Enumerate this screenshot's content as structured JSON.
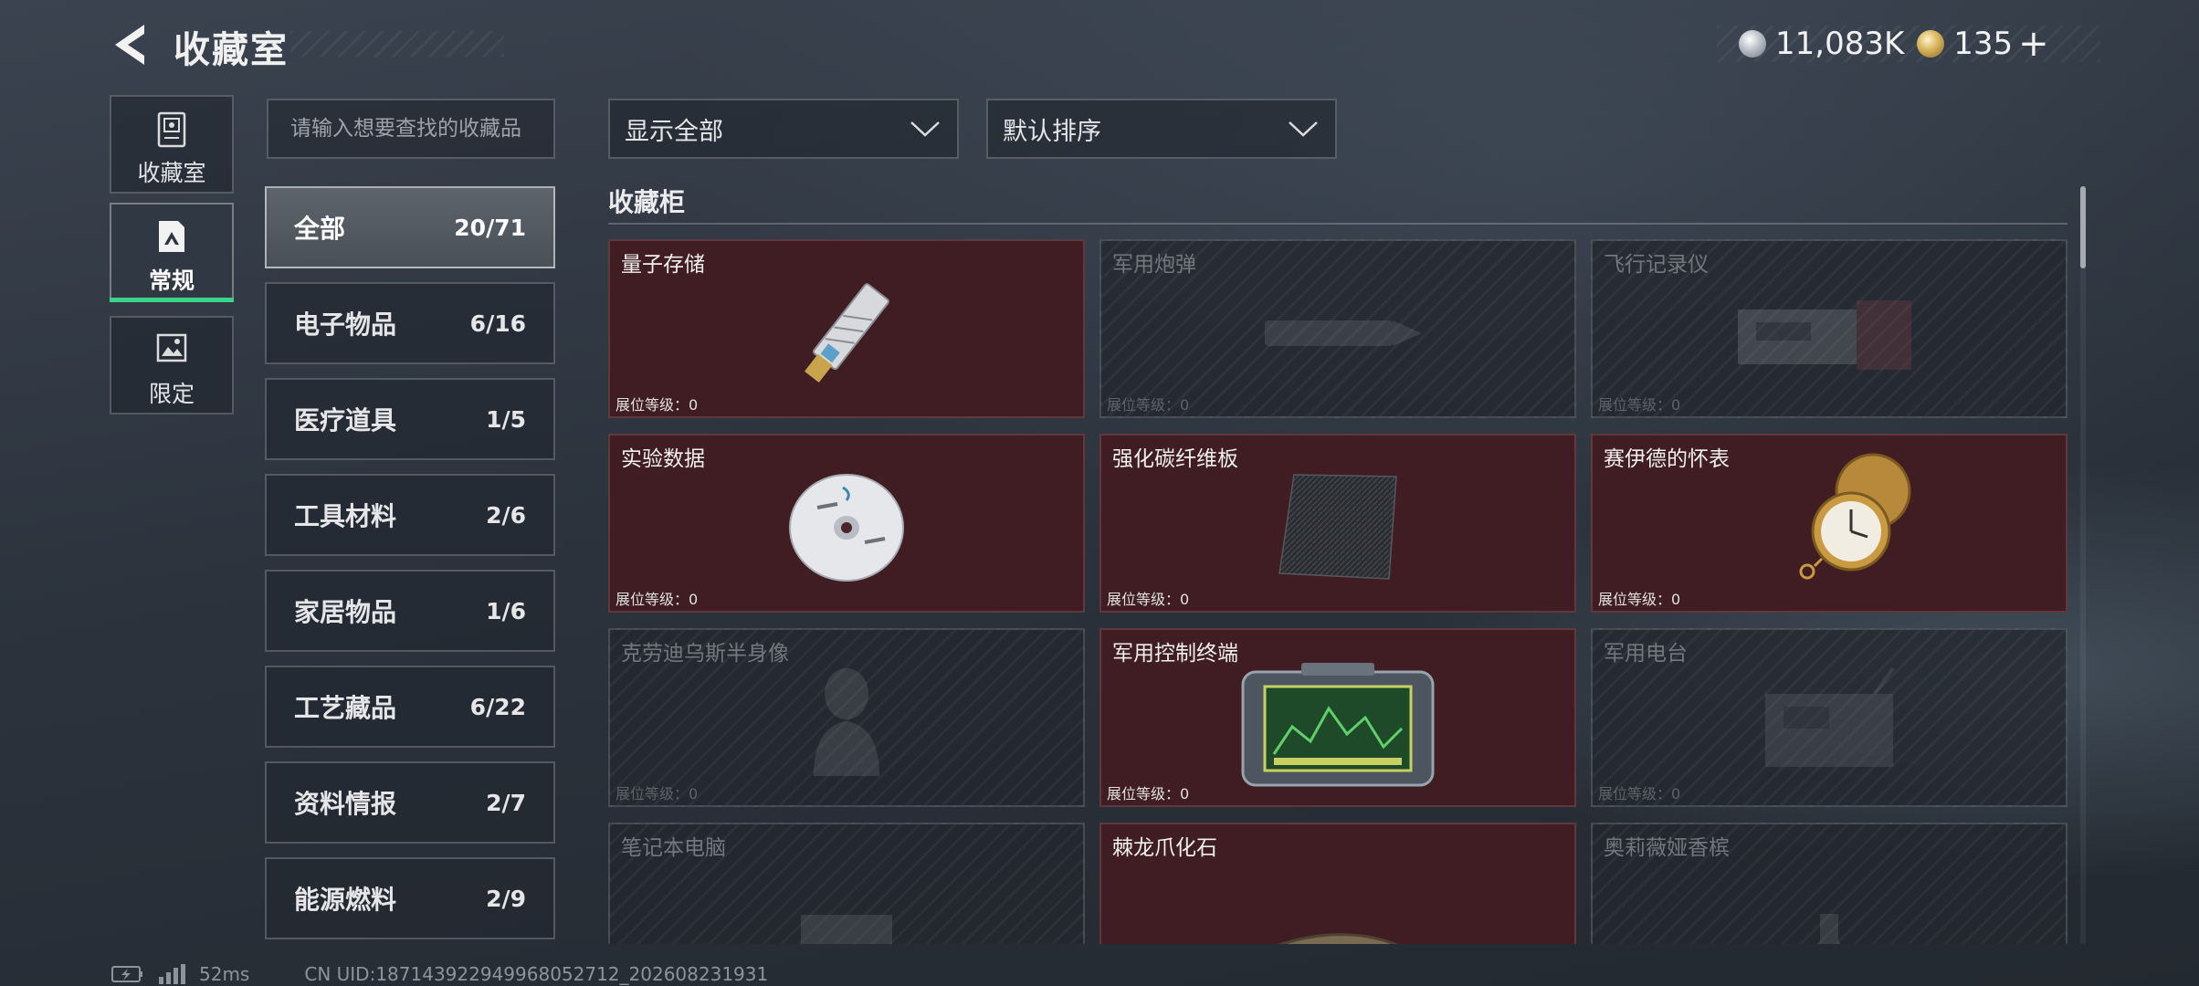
{
  "header": {
    "title": "收藏室",
    "silver_amount": "11,083K",
    "gold_amount": "135",
    "add_symbol": "+"
  },
  "side_tabs": [
    {
      "label": "收藏室",
      "icon": "collection-locker-icon"
    },
    {
      "label": "常规",
      "icon": "regular-image-icon",
      "active": true
    },
    {
      "label": "限定",
      "icon": "limited-image-icon"
    }
  ],
  "search": {
    "placeholder": "请输入想要查找的收藏品",
    "value": ""
  },
  "categories": [
    {
      "name": "全部",
      "count": "20/71",
      "active": true
    },
    {
      "name": "电子物品",
      "count": "6/16"
    },
    {
      "name": "医疗道具",
      "count": "1/5"
    },
    {
      "name": "工具材料",
      "count": "2/6"
    },
    {
      "name": "家居物品",
      "count": "1/6"
    },
    {
      "name": "工艺藏品",
      "count": "6/22"
    },
    {
      "name": "资料情报",
      "count": "2/7"
    },
    {
      "name": "能源燃料",
      "count": "2/9"
    }
  ],
  "filters": {
    "display": "显示全部",
    "sort": "默认排序"
  },
  "section_title": "收藏柜",
  "items": [
    {
      "name": "量子存储",
      "level": "展位等级：0",
      "owned": true,
      "icon": "usb-drive-icon"
    },
    {
      "name": "军用炮弹",
      "level": "展位等级：0",
      "owned": false,
      "icon": "artillery-shell-icon"
    },
    {
      "name": "飞行记录仪",
      "level": "展位等级：0",
      "owned": false,
      "icon": "flight-recorder-icon"
    },
    {
      "name": "实验数据",
      "level": "展位等级：0",
      "owned": true,
      "icon": "disc-icon"
    },
    {
      "name": "强化碳纤维板",
      "level": "展位等级：0",
      "owned": true,
      "icon": "carbon-plate-icon"
    },
    {
      "name": "赛伊德的怀表",
      "level": "展位等级：0",
      "owned": true,
      "icon": "pocket-watch-icon"
    },
    {
      "name": "克劳迪乌斯半身像",
      "level": "展位等级：0",
      "owned": false,
      "icon": "bust-statue-icon"
    },
    {
      "name": "军用控制终端",
      "level": "展位等级：0",
      "owned": true,
      "icon": "control-terminal-icon"
    },
    {
      "name": "军用电台",
      "level": "展位等级：0",
      "owned": false,
      "icon": "military-radio-icon"
    },
    {
      "name": "笔记本电脑",
      "level": "",
      "owned": false,
      "icon": "laptop-icon"
    },
    {
      "name": "棘龙爪化石",
      "level": "",
      "owned": true,
      "icon": "claw-fossil-icon"
    },
    {
      "name": "奥莉薇娅香槟",
      "level": "",
      "owned": false,
      "icon": "champagne-icon"
    }
  ],
  "status": {
    "ping": "52ms",
    "uid": "CN UID:18714392294996805271​2_202608231931"
  },
  "colors": {
    "owned_card": "#3f1d22",
    "accent_green": "#3bd28a",
    "background": "#2c333d"
  }
}
